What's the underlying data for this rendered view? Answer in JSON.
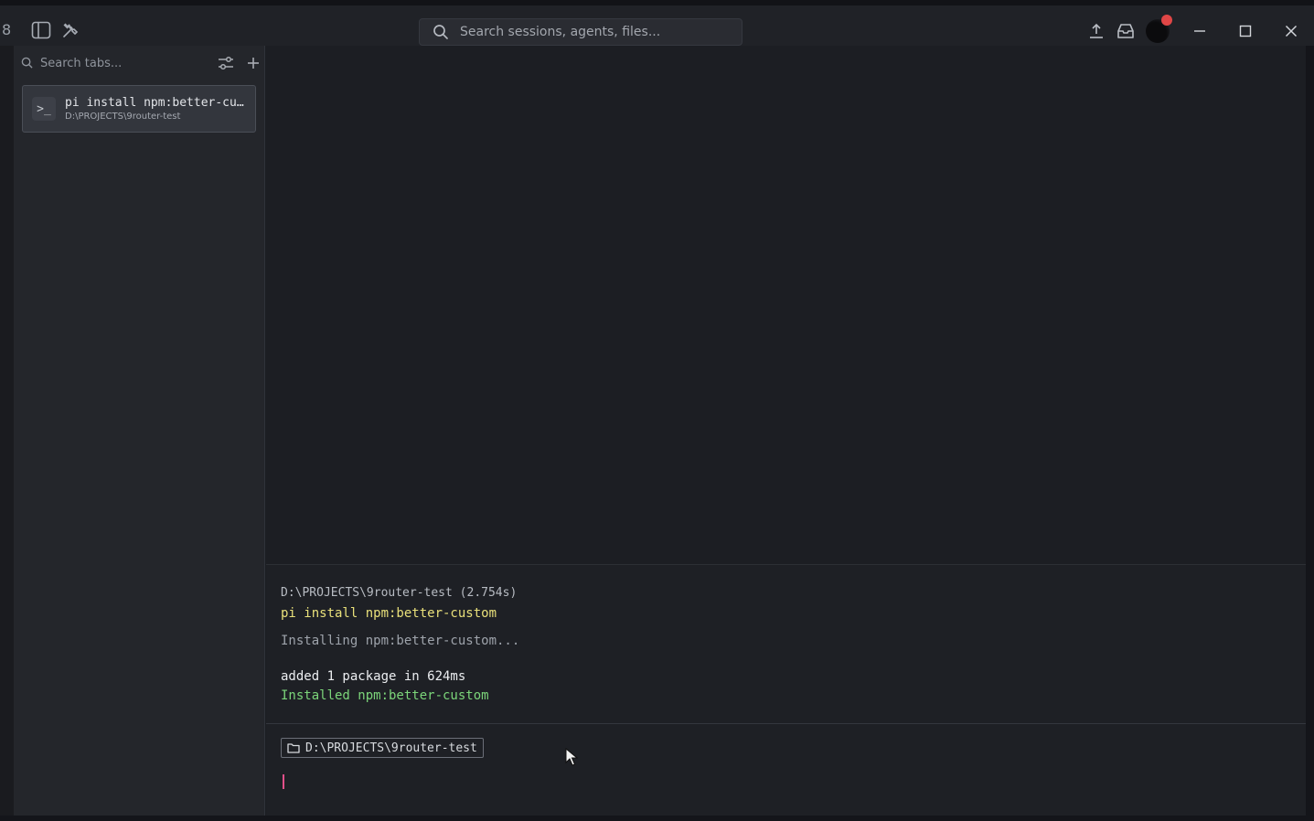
{
  "header": {
    "search_placeholder": "Search sessions, agents, files..."
  },
  "sidebar": {
    "search_placeholder": "Search tabs...",
    "tabs": [
      {
        "title": "pi install npm:better-cu…",
        "subtitle": "D:\\PROJECTS\\9router-test"
      }
    ]
  },
  "terminal": {
    "path_line": "D:\\PROJECTS\\9router-test (2.754s)",
    "command": "pi install npm:better-custom",
    "installing": "Installing npm:better-custom...",
    "added": "added 1 package in 624ms",
    "installed": "Installed npm:better-custom",
    "cwd": "D:\\PROJECTS\\9router-test"
  },
  "colors": {
    "accent_yellow": "#e9e07a",
    "success_green": "#7cd67a",
    "cursor_pink": "#e2508a",
    "notification_red": "#e04646"
  }
}
